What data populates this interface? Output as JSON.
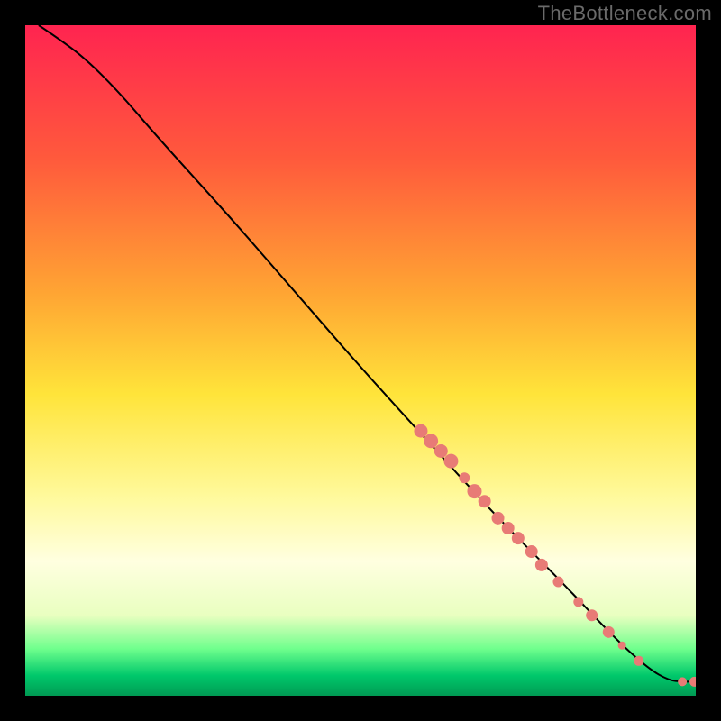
{
  "watermark": "TheBottleneck.com",
  "colors": {
    "page_bg": "#000000",
    "curve": "#000000",
    "dot_fill": "#e87b76",
    "dot_stroke": "#b84d49"
  },
  "chart_data": {
    "type": "line",
    "title": "",
    "xlabel": "",
    "ylabel": "",
    "xlim": [
      0,
      100
    ],
    "ylim": [
      0,
      100
    ],
    "gradient_stops": [
      {
        "offset": 0,
        "color": "#ff2450"
      },
      {
        "offset": 20,
        "color": "#ff5a3c"
      },
      {
        "offset": 40,
        "color": "#ffa533"
      },
      {
        "offset": 55,
        "color": "#ffe43a"
      },
      {
        "offset": 70,
        "color": "#fff99a"
      },
      {
        "offset": 80,
        "color": "#ffffe0"
      },
      {
        "offset": 88,
        "color": "#e9ffc0"
      },
      {
        "offset": 93,
        "color": "#6fff8d"
      },
      {
        "offset": 97,
        "color": "#00c86b"
      },
      {
        "offset": 100,
        "color": "#009a53"
      }
    ],
    "curve": [
      {
        "x": 2,
        "y": 100
      },
      {
        "x": 5,
        "y": 98
      },
      {
        "x": 9,
        "y": 95
      },
      {
        "x": 14,
        "y": 90
      },
      {
        "x": 20,
        "y": 83
      },
      {
        "x": 30,
        "y": 72
      },
      {
        "x": 40,
        "y": 60.5
      },
      {
        "x": 50,
        "y": 49
      },
      {
        "x": 60,
        "y": 38
      },
      {
        "x": 70,
        "y": 27
      },
      {
        "x": 80,
        "y": 17
      },
      {
        "x": 88,
        "y": 8.5
      },
      {
        "x": 93,
        "y": 4
      },
      {
        "x": 96,
        "y": 2.3
      },
      {
        "x": 98,
        "y": 2.1
      },
      {
        "x": 100,
        "y": 2.1
      }
    ],
    "points": [
      {
        "x": 59.0,
        "y": 39.5,
        "r": 7.5
      },
      {
        "x": 60.5,
        "y": 38.0,
        "r": 8.0
      },
      {
        "x": 62.0,
        "y": 36.5,
        "r": 7.5
      },
      {
        "x": 63.5,
        "y": 35.0,
        "r": 8.0
      },
      {
        "x": 65.5,
        "y": 32.5,
        "r": 6.0
      },
      {
        "x": 67.0,
        "y": 30.5,
        "r": 8.0
      },
      {
        "x": 68.5,
        "y": 29.0,
        "r": 7.0
      },
      {
        "x": 70.5,
        "y": 26.5,
        "r": 7.0
      },
      {
        "x": 72.0,
        "y": 25.0,
        "r": 7.0
      },
      {
        "x": 73.5,
        "y": 23.5,
        "r": 7.0
      },
      {
        "x": 75.5,
        "y": 21.5,
        "r": 7.0
      },
      {
        "x": 77.0,
        "y": 19.5,
        "r": 7.0
      },
      {
        "x": 79.5,
        "y": 17.0,
        "r": 6.0
      },
      {
        "x": 82.5,
        "y": 14.0,
        "r": 5.5
      },
      {
        "x": 84.5,
        "y": 12.0,
        "r": 6.5
      },
      {
        "x": 87.0,
        "y": 9.5,
        "r": 6.5
      },
      {
        "x": 89.0,
        "y": 7.5,
        "r": 4.5
      },
      {
        "x": 91.5,
        "y": 5.2,
        "r": 5.5
      },
      {
        "x": 98.0,
        "y": 2.1,
        "r": 5.0
      },
      {
        "x": 99.8,
        "y": 2.1,
        "r": 5.5
      }
    ]
  }
}
